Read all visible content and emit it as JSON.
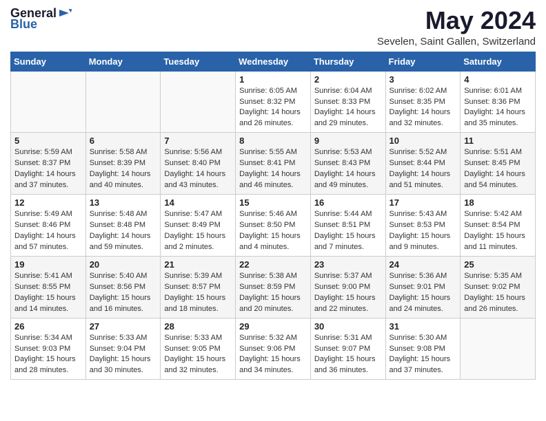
{
  "logo": {
    "general": "General",
    "blue": "Blue"
  },
  "title": "May 2024",
  "subtitle": "Sevelen, Saint Gallen, Switzerland",
  "headers": [
    "Sunday",
    "Monday",
    "Tuesday",
    "Wednesday",
    "Thursday",
    "Friday",
    "Saturday"
  ],
  "weeks": [
    [
      {
        "day": "",
        "info": ""
      },
      {
        "day": "",
        "info": ""
      },
      {
        "day": "",
        "info": ""
      },
      {
        "day": "1",
        "info": "Sunrise: 6:05 AM\nSunset: 8:32 PM\nDaylight: 14 hours\nand 26 minutes."
      },
      {
        "day": "2",
        "info": "Sunrise: 6:04 AM\nSunset: 8:33 PM\nDaylight: 14 hours\nand 29 minutes."
      },
      {
        "day": "3",
        "info": "Sunrise: 6:02 AM\nSunset: 8:35 PM\nDaylight: 14 hours\nand 32 minutes."
      },
      {
        "day": "4",
        "info": "Sunrise: 6:01 AM\nSunset: 8:36 PM\nDaylight: 14 hours\nand 35 minutes."
      }
    ],
    [
      {
        "day": "5",
        "info": "Sunrise: 5:59 AM\nSunset: 8:37 PM\nDaylight: 14 hours\nand 37 minutes."
      },
      {
        "day": "6",
        "info": "Sunrise: 5:58 AM\nSunset: 8:39 PM\nDaylight: 14 hours\nand 40 minutes."
      },
      {
        "day": "7",
        "info": "Sunrise: 5:56 AM\nSunset: 8:40 PM\nDaylight: 14 hours\nand 43 minutes."
      },
      {
        "day": "8",
        "info": "Sunrise: 5:55 AM\nSunset: 8:41 PM\nDaylight: 14 hours\nand 46 minutes."
      },
      {
        "day": "9",
        "info": "Sunrise: 5:53 AM\nSunset: 8:43 PM\nDaylight: 14 hours\nand 49 minutes."
      },
      {
        "day": "10",
        "info": "Sunrise: 5:52 AM\nSunset: 8:44 PM\nDaylight: 14 hours\nand 51 minutes."
      },
      {
        "day": "11",
        "info": "Sunrise: 5:51 AM\nSunset: 8:45 PM\nDaylight: 14 hours\nand 54 minutes."
      }
    ],
    [
      {
        "day": "12",
        "info": "Sunrise: 5:49 AM\nSunset: 8:46 PM\nDaylight: 14 hours\nand 57 minutes."
      },
      {
        "day": "13",
        "info": "Sunrise: 5:48 AM\nSunset: 8:48 PM\nDaylight: 14 hours\nand 59 minutes."
      },
      {
        "day": "14",
        "info": "Sunrise: 5:47 AM\nSunset: 8:49 PM\nDaylight: 15 hours\nand 2 minutes."
      },
      {
        "day": "15",
        "info": "Sunrise: 5:46 AM\nSunset: 8:50 PM\nDaylight: 15 hours\nand 4 minutes."
      },
      {
        "day": "16",
        "info": "Sunrise: 5:44 AM\nSunset: 8:51 PM\nDaylight: 15 hours\nand 7 minutes."
      },
      {
        "day": "17",
        "info": "Sunrise: 5:43 AM\nSunset: 8:53 PM\nDaylight: 15 hours\nand 9 minutes."
      },
      {
        "day": "18",
        "info": "Sunrise: 5:42 AM\nSunset: 8:54 PM\nDaylight: 15 hours\nand 11 minutes."
      }
    ],
    [
      {
        "day": "19",
        "info": "Sunrise: 5:41 AM\nSunset: 8:55 PM\nDaylight: 15 hours\nand 14 minutes."
      },
      {
        "day": "20",
        "info": "Sunrise: 5:40 AM\nSunset: 8:56 PM\nDaylight: 15 hours\nand 16 minutes."
      },
      {
        "day": "21",
        "info": "Sunrise: 5:39 AM\nSunset: 8:57 PM\nDaylight: 15 hours\nand 18 minutes."
      },
      {
        "day": "22",
        "info": "Sunrise: 5:38 AM\nSunset: 8:59 PM\nDaylight: 15 hours\nand 20 minutes."
      },
      {
        "day": "23",
        "info": "Sunrise: 5:37 AM\nSunset: 9:00 PM\nDaylight: 15 hours\nand 22 minutes."
      },
      {
        "day": "24",
        "info": "Sunrise: 5:36 AM\nSunset: 9:01 PM\nDaylight: 15 hours\nand 24 minutes."
      },
      {
        "day": "25",
        "info": "Sunrise: 5:35 AM\nSunset: 9:02 PM\nDaylight: 15 hours\nand 26 minutes."
      }
    ],
    [
      {
        "day": "26",
        "info": "Sunrise: 5:34 AM\nSunset: 9:03 PM\nDaylight: 15 hours\nand 28 minutes."
      },
      {
        "day": "27",
        "info": "Sunrise: 5:33 AM\nSunset: 9:04 PM\nDaylight: 15 hours\nand 30 minutes."
      },
      {
        "day": "28",
        "info": "Sunrise: 5:33 AM\nSunset: 9:05 PM\nDaylight: 15 hours\nand 32 minutes."
      },
      {
        "day": "29",
        "info": "Sunrise: 5:32 AM\nSunset: 9:06 PM\nDaylight: 15 hours\nand 34 minutes."
      },
      {
        "day": "30",
        "info": "Sunrise: 5:31 AM\nSunset: 9:07 PM\nDaylight: 15 hours\nand 36 minutes."
      },
      {
        "day": "31",
        "info": "Sunrise: 5:30 AM\nSunset: 9:08 PM\nDaylight: 15 hours\nand 37 minutes."
      },
      {
        "day": "",
        "info": ""
      }
    ]
  ]
}
